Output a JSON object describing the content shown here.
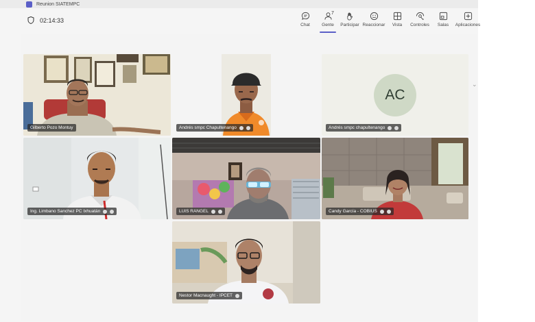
{
  "window": {
    "title": "Reunion SIATEMPC"
  },
  "meeting": {
    "timer": "02:14:33"
  },
  "toolbar": {
    "items": [
      {
        "label": "Chat",
        "icon": "chat-icon"
      },
      {
        "label": "Gente",
        "icon": "people-icon",
        "count": "7"
      },
      {
        "label": "Participar",
        "icon": "raise-hand-icon"
      },
      {
        "label": "Reaccionar",
        "icon": "smiley-icon"
      },
      {
        "label": "Vista",
        "icon": "grid-view-icon"
      },
      {
        "label": "Controles",
        "icon": "controls-icon"
      },
      {
        "label": "Salas",
        "icon": "rooms-icon"
      },
      {
        "label": "Aplicaciones",
        "icon": "add-apps-icon"
      }
    ]
  },
  "participants": [
    {
      "name": "Gilberto Pozo Montuy"
    },
    {
      "name": "Andrés smpc Chapultenango"
    },
    {
      "name": "Andrés smpc chapultenango",
      "initials": "AC"
    },
    {
      "name": "Ing. Limbano Sanchez PC Ixhuatán"
    },
    {
      "name": "LUIS RANGEL"
    },
    {
      "name": "Candy García - COBIUS"
    },
    {
      "name": "Nestor Macnaught - IPCET"
    }
  ],
  "colors": {
    "accent": "#5b5fc7"
  }
}
